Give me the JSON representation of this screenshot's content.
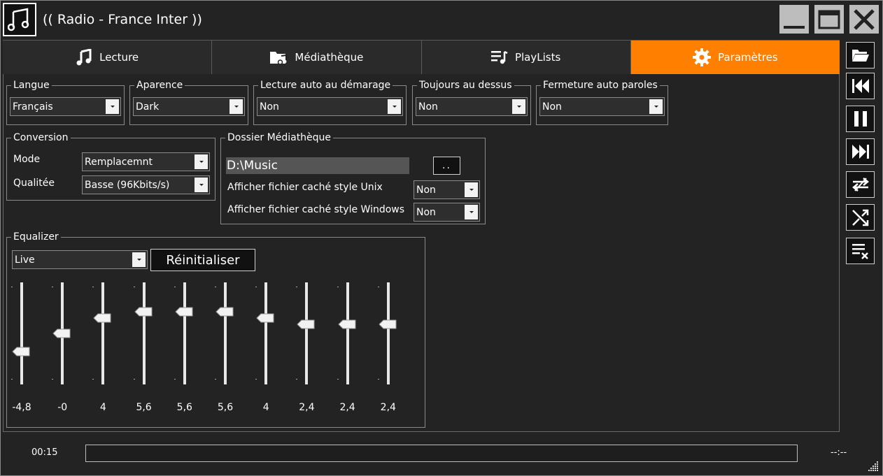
{
  "window": {
    "title": "(( Radio - France Inter ))"
  },
  "tabs": [
    {
      "label": "Lecture",
      "icon": "music-note-icon",
      "active": false
    },
    {
      "label": "Médiathèque",
      "icon": "folder-music-icon",
      "active": false
    },
    {
      "label": "PlayLists",
      "icon": "playlist-icon",
      "active": false
    },
    {
      "label": "Paramètres",
      "icon": "gear-icon",
      "active": true
    }
  ],
  "settings": {
    "langue": {
      "title": "Langue",
      "value": "Français"
    },
    "apparence": {
      "title": "Aparence",
      "value": "Dark"
    },
    "lecture_auto": {
      "title": "Lecture auto au démarage",
      "value": "Non"
    },
    "toujours_dessus": {
      "title": "Toujours au dessus",
      "value": "Non"
    },
    "fermeture_auto": {
      "title": "Fermeture auto paroles",
      "value": "Non"
    }
  },
  "conversion": {
    "title": "Conversion",
    "mode_label": "Mode",
    "mode_value": "Remplacemnt",
    "qualite_label": "Qualitée",
    "qualite_value": "Basse (96Kbits/s)"
  },
  "dossier": {
    "title": "Dossier Médiathèque",
    "path": "D:\\Music",
    "browse_label": "..",
    "unix_label": "Afficher fichier caché style Unix",
    "unix_value": "Non",
    "windows_label": "Afficher fichier caché style Windows",
    "windows_value": "Non"
  },
  "equalizer": {
    "title": "Equalizer",
    "preset": "Live",
    "reset_label": "Réinitialiser",
    "range": [
      -12,
      12
    ],
    "bands": [
      {
        "value": -4.8,
        "label": "-4,8"
      },
      {
        "value": 0,
        "label": "-0"
      },
      {
        "value": 4,
        "label": "4"
      },
      {
        "value": 5.6,
        "label": "5,6"
      },
      {
        "value": 5.6,
        "label": "5,6"
      },
      {
        "value": 5.6,
        "label": "5,6"
      },
      {
        "value": 4,
        "label": "4"
      },
      {
        "value": 2.4,
        "label": "2,4"
      },
      {
        "value": 2.4,
        "label": "2,4"
      },
      {
        "value": 2.4,
        "label": "2,4"
      }
    ]
  },
  "player": {
    "current_time": "00:15",
    "end_time": "--:--",
    "progress_fraction": 0
  },
  "colors": {
    "accent": "#ff7f00",
    "background": "#232323"
  }
}
